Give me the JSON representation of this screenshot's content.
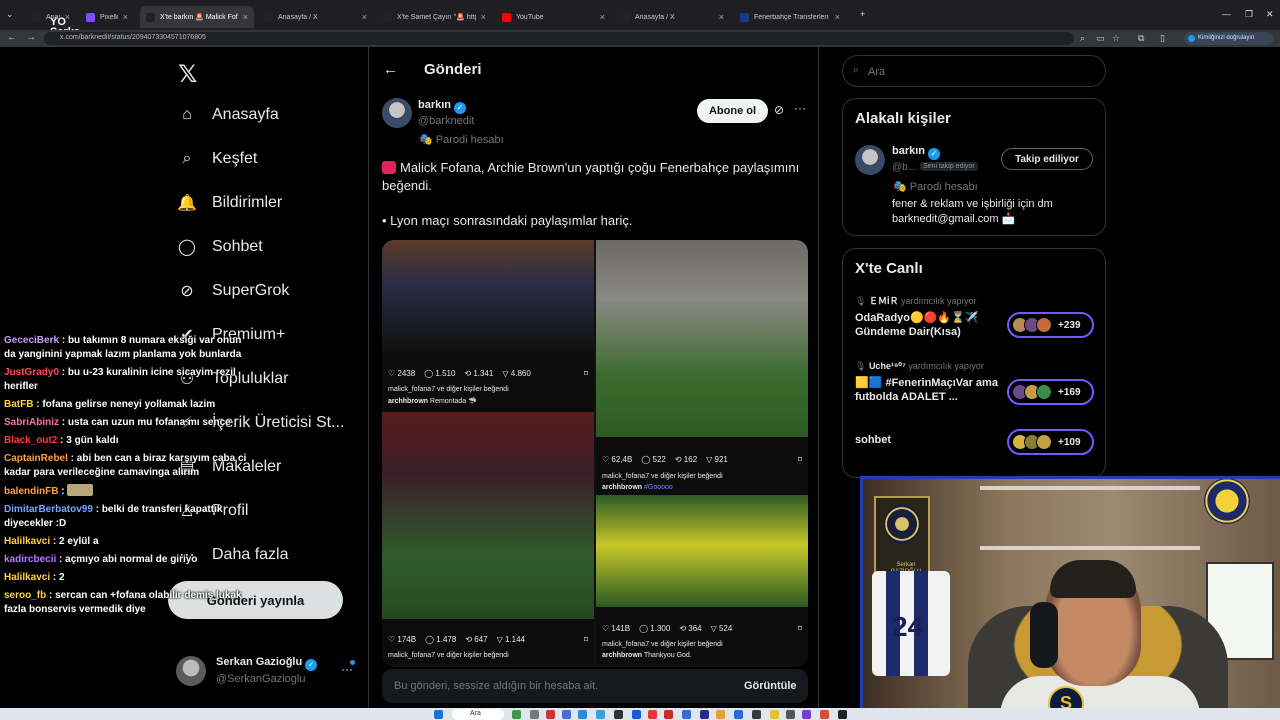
{
  "browser": {
    "tabs": [
      {
        "title": "Anasayfa",
        "icon": "x-logo",
        "color": "#222"
      },
      {
        "title": "Pixelkit -",
        "icon": "pixelkit",
        "color": "#7c4dff"
      },
      {
        "title": "X'te barkın 🚨 Malick Fofana...",
        "icon": "x-logo",
        "color": "#222",
        "active": true
      },
      {
        "title": "Anasayfa / X",
        "icon": "x-logo",
        "color": "#222"
      },
      {
        "title": "X'te Samet Çayırı \"🚨 https:...",
        "icon": "x-logo",
        "color": "#222"
      },
      {
        "title": "YouTube",
        "icon": "youtube",
        "color": "#ff0000"
      },
      {
        "title": "Anasayfa / X",
        "icon": "x-logo",
        "color": "#222"
      },
      {
        "title": "Fenerbahçe Transferleri – Tüm...",
        "icon": "transfermarkt",
        "color": "#1a3a8a"
      }
    ],
    "url": "x.com/barknedit/status/2094073304571076805",
    "profile_label": "Kimliğinizi doğrulayın"
  },
  "stream": {
    "logo_line1": "YO",
    "logo_line2": "Serka"
  },
  "nav": {
    "items": [
      {
        "label": "Anasayfa",
        "icon": "home-icon"
      },
      {
        "label": "Keşfet",
        "icon": "search-icon"
      },
      {
        "label": "Bildirimler",
        "icon": "bell-icon"
      },
      {
        "label": "Sohbet",
        "icon": "chat-icon"
      },
      {
        "label": "SuperGrok",
        "icon": "grok-icon"
      },
      {
        "label": "Premium+",
        "icon": "premium-icon"
      },
      {
        "label": "Topluluklar",
        "icon": "communities-icon"
      },
      {
        "label": "İçerik Üreticisi St...",
        "icon": "creator-icon"
      },
      {
        "label": "Makaleler",
        "icon": "articles-icon"
      },
      {
        "label": "Profil",
        "icon": "profile-icon"
      },
      {
        "label": "Daha fazla",
        "icon": "more-icon"
      }
    ],
    "post_button": "Gönderi yayınla",
    "me": {
      "name": "Serkan Gazioğlu",
      "handle": "@SerkanGazioglu"
    }
  },
  "post": {
    "header": "Gönderi",
    "author": {
      "name": "barkın",
      "handle": "@barknedit",
      "label": "Parodi hesabı"
    },
    "subscribe": "Abone ol",
    "text1": "Malick Fofana, Archie Brown'un yaptığı çoğu Fenerbahçe paylaşımını beğendi.",
    "text2": "• Lyon maçı sonrasındaki paylaşımlar hariç.",
    "tiles": [
      {
        "likes": "2438",
        "replies": "1.510",
        "reposts": "1.341",
        "views": "4.860",
        "liked_by": "malick_fofana7 ve diğer kişiler beğendi",
        "user": "archhbrown",
        "caption": "Remontada 🦈"
      },
      {
        "likes": "62,4B",
        "replies": "522",
        "reposts": "162",
        "views": "921",
        "liked_by": "malick_fofana7 ve diğer kişiler beğendi",
        "user": "archhbrown",
        "caption": "#Gooooo"
      },
      {
        "likes": "174B",
        "replies": "1.478",
        "reposts": "647",
        "views": "1.144",
        "liked_by": "malick_fofana7 ve diğer kişiler beğendi",
        "user": "archhbrown",
        "caption": ""
      },
      {
        "likes": "141B",
        "replies": "1.300",
        "reposts": "364",
        "views": "524",
        "liked_by": "malick_fofana7 ve diğer kişiler beğendi",
        "user": "archhbrown",
        "caption": "Thankyou God."
      }
    ],
    "muted_notice": "Bu gönderi, sessize aldığın bir hesaba ait.",
    "view_label": "Görüntüle"
  },
  "sidebar": {
    "search_placeholder": "Ara",
    "related_title": "Alakalı kişiler",
    "related": {
      "name": "barkın",
      "handle": "@b...",
      "follows_you": "Seni takip ediyor",
      "label": "Parodi hesabı",
      "bio": "fener & reklam ve işbirliği için dm barknedit@gmail.com 📩",
      "follow_button": "Takip ediliyor"
    },
    "live_title": "X'te Canlı",
    "live": [
      {
        "host": "ＥＭİＲ",
        "status": "yardımcılık yapıyor",
        "title": "OdaRadyo🟡🔴🔥⏳✈️ Gündeme Dair(Kısa)",
        "count": "+239"
      },
      {
        "host": "Uche¹⁹⁰⁷",
        "status": "yardımcılık yapıyor",
        "title": "🟨🟦 #FenerinMaçıVar ama futbolda ADALET ...",
        "count": "+169"
      },
      {
        "host": "",
        "status": "",
        "title": "sohbet",
        "count": "+109"
      }
    ]
  },
  "chat": [
    {
      "user": "GececiBerk",
      "color": "#c89bff",
      "text": "bu takımın 8 numara eksiği var onun da yanginini yapmak lazım planlama yok bunlarda"
    },
    {
      "user": "JustGrady0",
      "color": "#ff4d4d",
      "text": "bu u-23 kuralinin icine sicayim rezil herifler"
    },
    {
      "user": "BatFB",
      "color": "#ffd23f",
      "text": "fofana gelirse neneyi yollamak lazim"
    },
    {
      "user": "SabriAbiniz",
      "color": "#ff6fa8",
      "text": "usta can uzun mu fofana mı sence"
    },
    {
      "user": "Black_out2",
      "color": "#ff3b3b",
      "text": "3 gün kaldı"
    },
    {
      "user": "CaptainRebel",
      "color": "#ff9f40",
      "text": "abi ben can a biraz karşıyım caba ci kadar para verileceğine camavinga alırım"
    },
    {
      "user": "balendinFB",
      "color": "#ff9f40",
      "text": ""
    },
    {
      "user": "DimitarBerbatov99",
      "color": "#7aa5ff",
      "text": "belki de transferi kapattık diyecekler :D"
    },
    {
      "user": "Halilkavci",
      "color": "#ffd23f",
      "text": "2 eylül a"
    },
    {
      "user": "kadircbecii",
      "color": "#b77bff",
      "text": "açmıyo abi normal de giriyo"
    },
    {
      "user": "Halilkavci",
      "color": "#ffd23f",
      "text": "2"
    },
    {
      "user": "seroo_fb",
      "color": "#ffd23f",
      "text": "sercan can +fofana olabilir demiş lukak fazla bonservis vermedik diye"
    }
  ],
  "webcam": {
    "plate_text": "Serkan GAZİOĞLU",
    "jersey_number": "24",
    "logo_letter": "S"
  },
  "taskbar": {
    "search_label": "Ara"
  },
  "colors": {
    "accent": "#1d9bf0",
    "live_ring": "#7856ff",
    "background": "#000000"
  }
}
